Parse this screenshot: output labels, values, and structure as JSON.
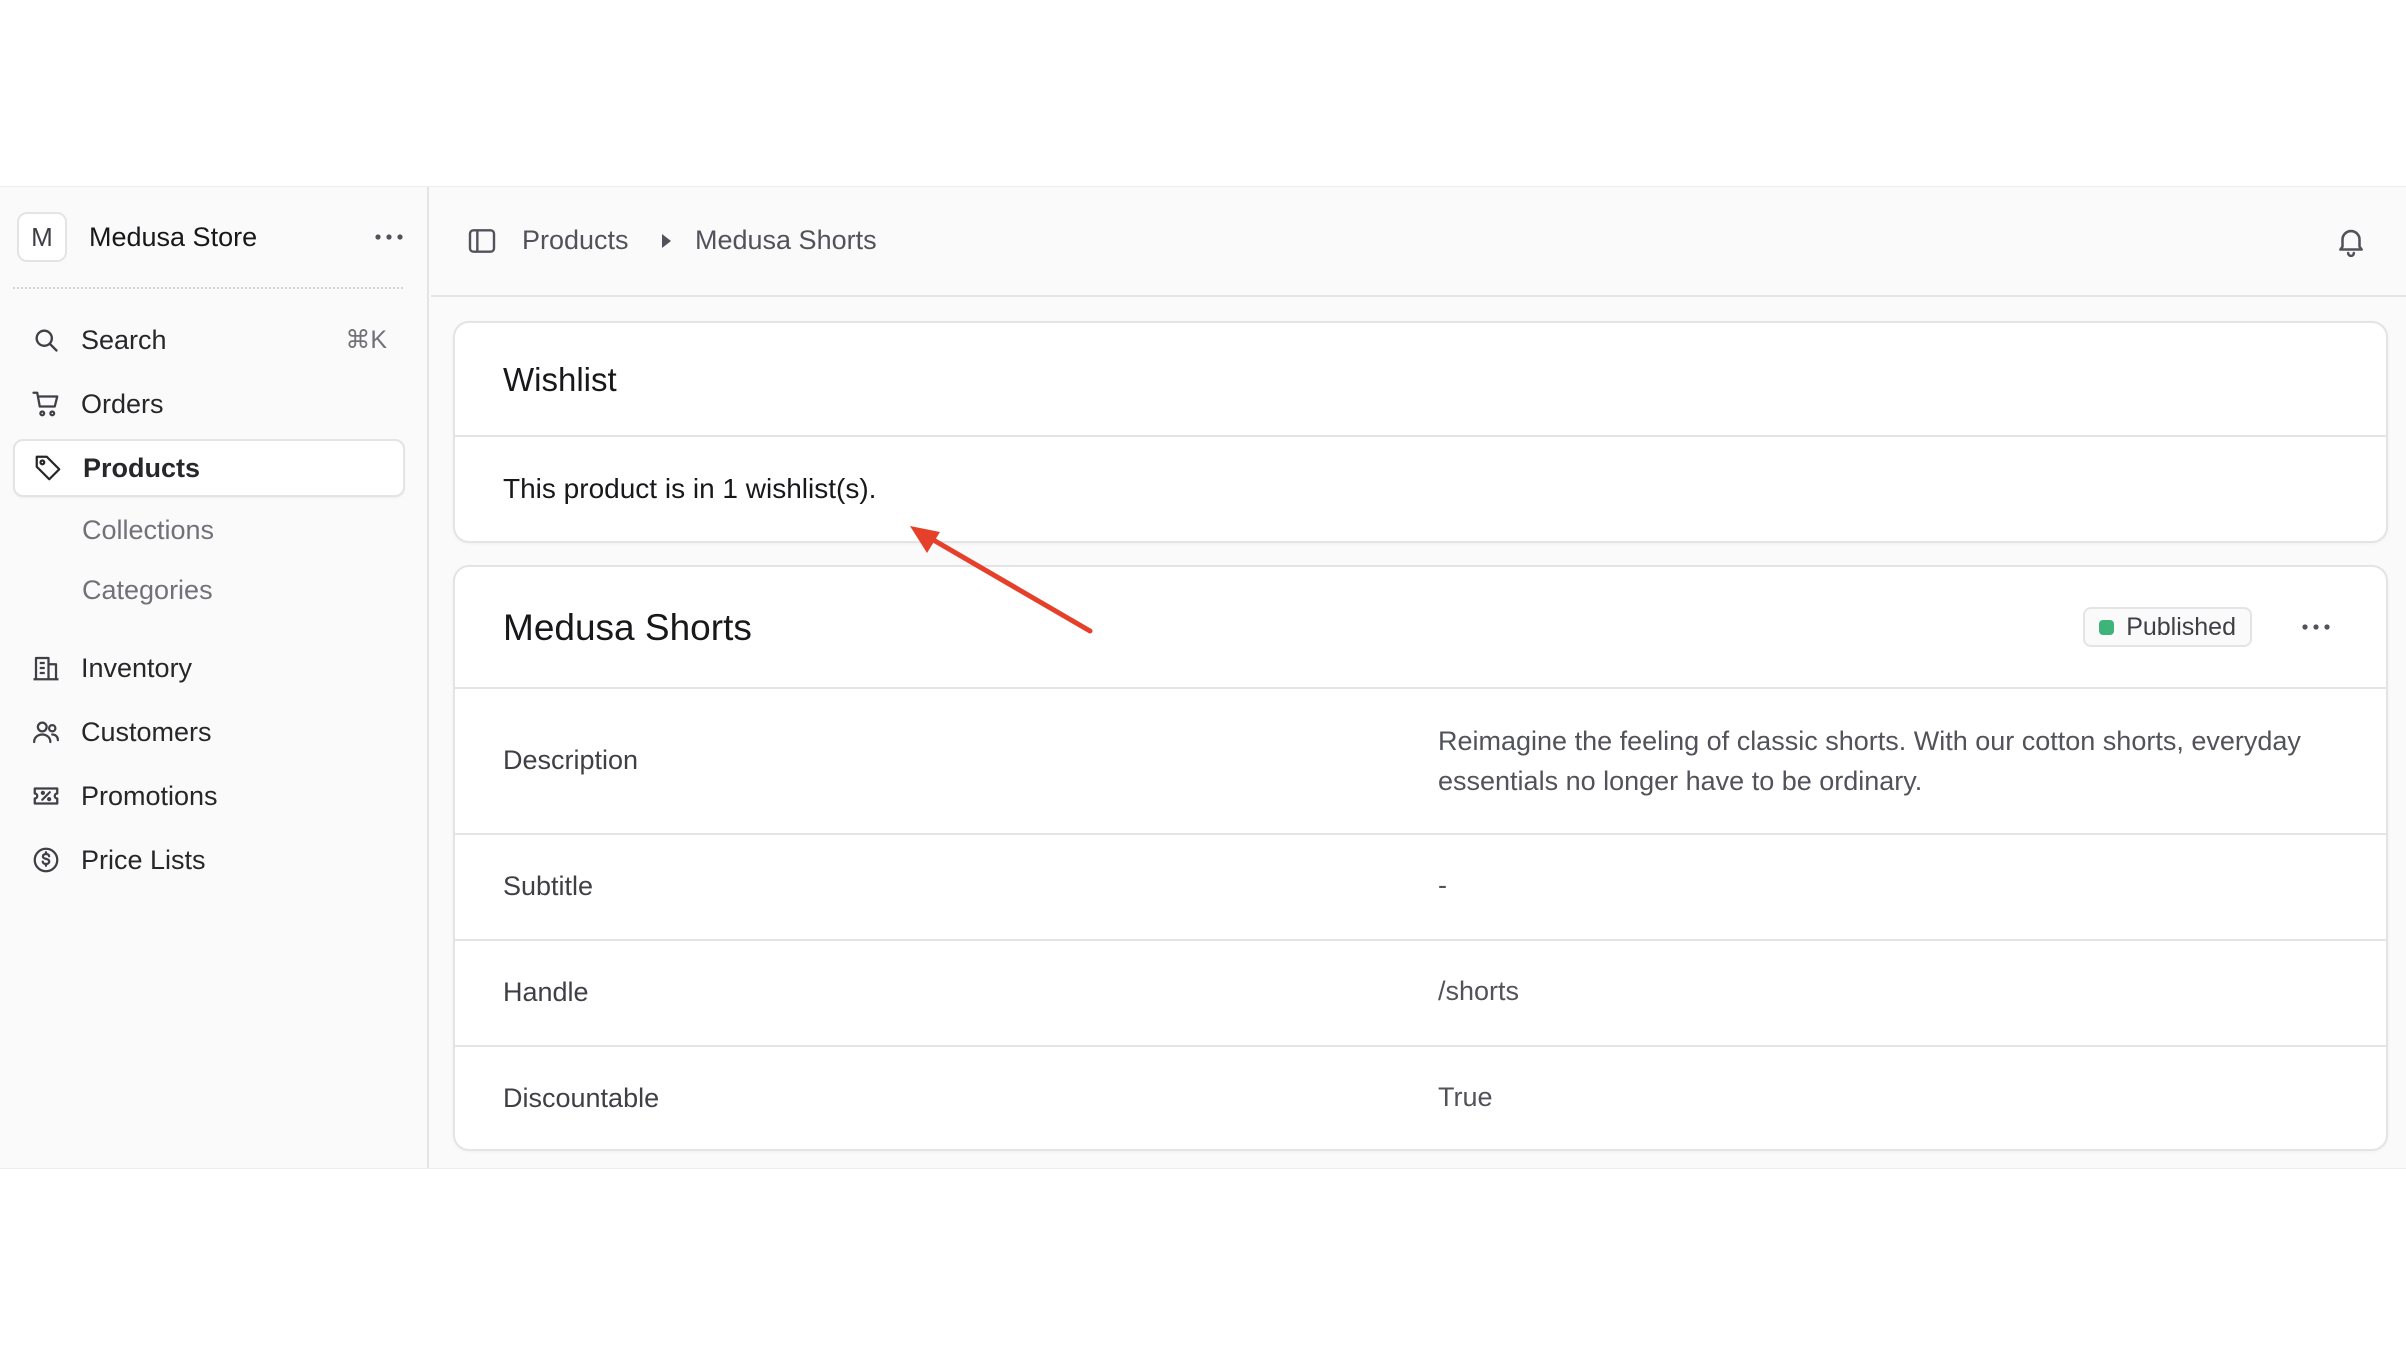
{
  "store": {
    "initial": "M",
    "name": "Medusa Store"
  },
  "sidebar": {
    "search": {
      "label": "Search",
      "shortcut": "⌘K"
    },
    "items": [
      {
        "label": "Orders",
        "icon": "cart-icon"
      },
      {
        "label": "Products",
        "icon": "tag-icon",
        "active": true
      },
      {
        "label": "Inventory",
        "icon": "building-icon"
      },
      {
        "label": "Customers",
        "icon": "users-icon"
      },
      {
        "label": "Promotions",
        "icon": "receipt-percent-icon"
      },
      {
        "label": "Price Lists",
        "icon": "currency-dollar-icon"
      }
    ],
    "sub_items": [
      "Collections",
      "Categories"
    ]
  },
  "breadcrumb": {
    "items": [
      "Products",
      "Medusa Shorts"
    ]
  },
  "wishlist": {
    "title": "Wishlist",
    "text": "This product is in 1 wishlist(s)."
  },
  "product": {
    "title": "Medusa Shorts",
    "status": "Published",
    "status_color": "#3fb47a",
    "rows": [
      {
        "label": "Description",
        "value": "Reimagine the feeling of classic shorts. With our cotton shorts, everyday essentials no longer have to be ordinary."
      },
      {
        "label": "Subtitle",
        "value": "-"
      },
      {
        "label": "Handle",
        "value": "/shorts"
      },
      {
        "label": "Discountable",
        "value": "True"
      }
    ]
  },
  "annotation": {
    "color": "#e5402a"
  }
}
